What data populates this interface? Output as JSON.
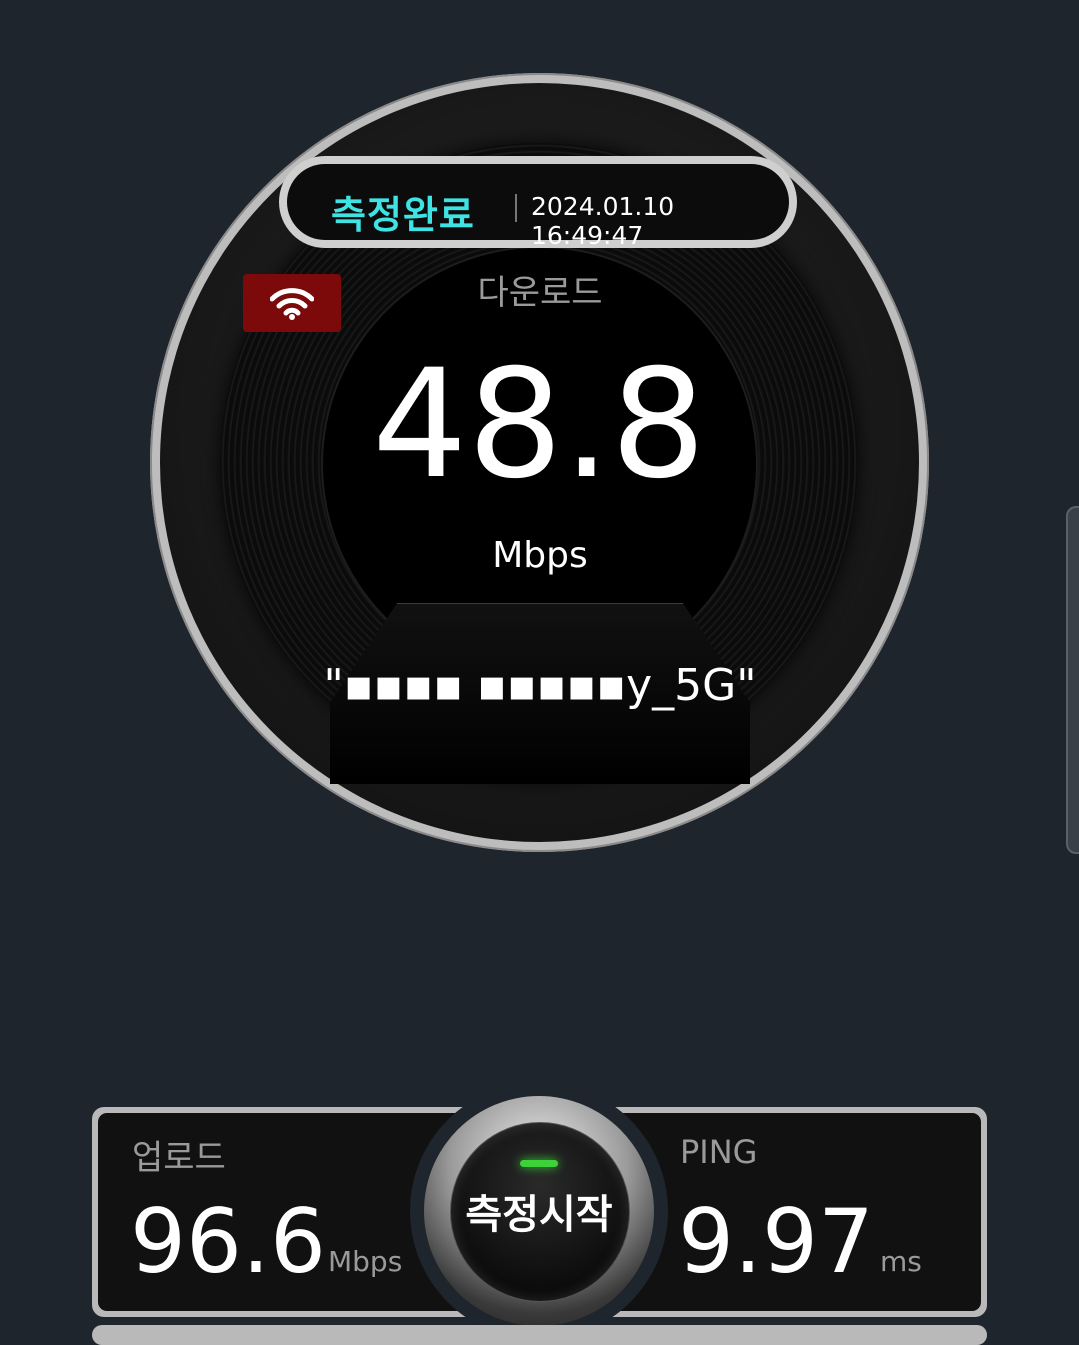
{
  "status": {
    "label": "측정완료",
    "timestamp": "2024.01.10 16:49:47"
  },
  "connection": {
    "type_icon": "wifi-icon",
    "badge_color": "#7d0a0a",
    "network_name": "\"▪▪▪▪ ▪▪▪▪▪y_5G\""
  },
  "download": {
    "label": "다운로드",
    "value": "48.8",
    "unit": "Mbps"
  },
  "upload": {
    "label": "업로드",
    "value": "96.6",
    "unit": "Mbps"
  },
  "ping": {
    "label": "PING",
    "value": "9.97",
    "unit": "ms"
  },
  "start_button": {
    "label": "측정시작",
    "indicator_color": "#3ed23a"
  },
  "colors": {
    "status_text": "#3fe3e3",
    "background": "#1f252c"
  }
}
